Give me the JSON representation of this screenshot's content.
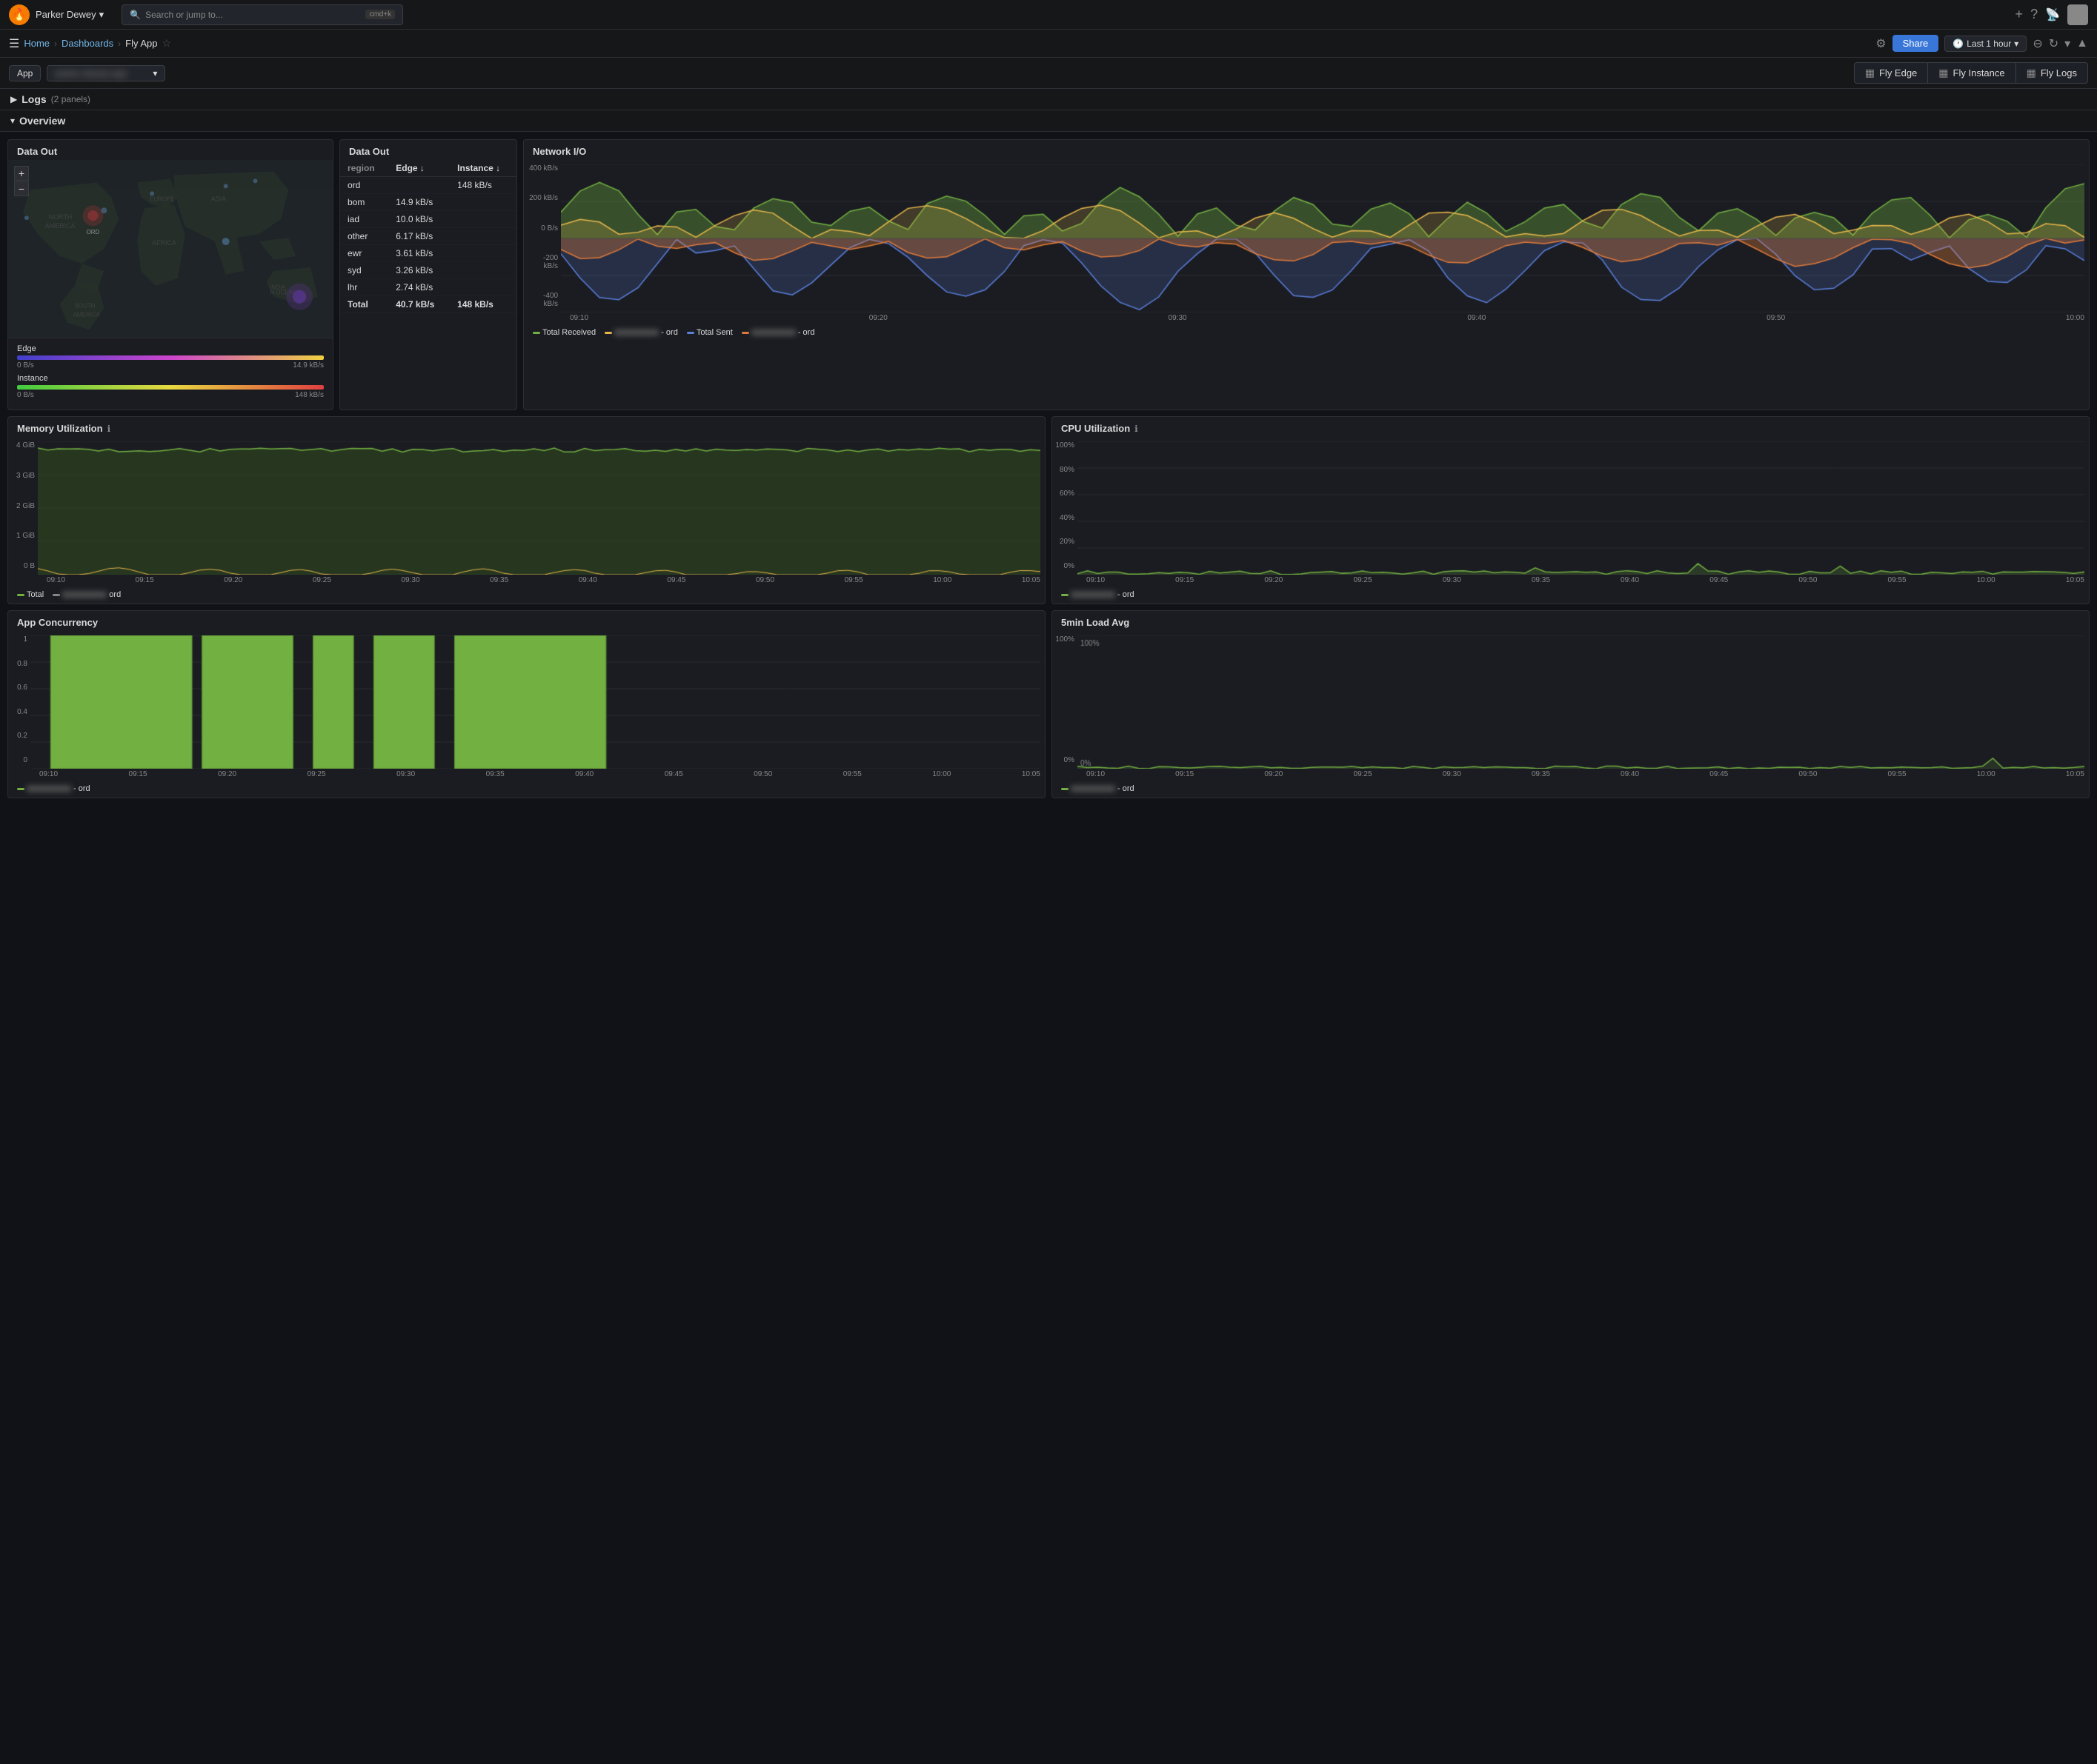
{
  "app": {
    "logo": "🔥",
    "org": "Parker Dewey",
    "search_placeholder": "Search or jump to...",
    "search_shortcut": "cmd+k"
  },
  "breadcrumb": {
    "home": "Home",
    "dashboards": "Dashboards",
    "current": "Fly App",
    "sep": "›"
  },
  "toolbar": {
    "share_label": "Share",
    "time_range": "Last 1 hour",
    "settings_icon": "⚙",
    "refresh_icon": "↻",
    "zoom_out_icon": "🔍",
    "chevron_icon": "▾"
  },
  "app_row": {
    "app_label": "App",
    "app_name": "parker-dewey-app",
    "tabs": [
      {
        "id": "fly-edge",
        "label": "Fly Edge",
        "icon": "▦"
      },
      {
        "id": "fly-instance",
        "label": "Fly Instance",
        "icon": "▦"
      },
      {
        "id": "fly-logs",
        "label": "Fly Logs",
        "icon": "▦"
      }
    ]
  },
  "logs_section": {
    "label": "Logs",
    "count": "(2 panels)"
  },
  "overview_section": {
    "label": "Overview"
  },
  "data_out_map": {
    "title": "Data Out",
    "edge_label": "Edge",
    "edge_min": "0 B/s",
    "edge_max": "14.9 kB/s",
    "instance_label": "Instance",
    "instance_min": "0 B/s",
    "instance_max": "148 kB/s"
  },
  "data_out_table": {
    "title": "Data Out",
    "headers": [
      "region",
      "Edge ↓",
      "Instance ↓"
    ],
    "rows": [
      {
        "region": "ord",
        "edge": "",
        "instance": "148 kB/s"
      },
      {
        "region": "bom",
        "edge": "14.9 kB/s",
        "instance": ""
      },
      {
        "region": "iad",
        "edge": "10.0 kB/s",
        "instance": ""
      },
      {
        "region": "other",
        "edge": "6.17 kB/s",
        "instance": ""
      },
      {
        "region": "ewr",
        "edge": "3.61 kB/s",
        "instance": ""
      },
      {
        "region": "syd",
        "edge": "3.26 kB/s",
        "instance": ""
      },
      {
        "region": "lhr",
        "edge": "2.74 kB/s",
        "instance": ""
      },
      {
        "region": "Total",
        "edge": "40.7 kB/s",
        "instance": "148 kB/s"
      }
    ]
  },
  "network_io": {
    "title": "Network I/O",
    "y_labels": [
      "400 kB/s",
      "200 kB/s",
      "0 B/s",
      "-200 kB/s",
      "-400 kB/s"
    ],
    "x_labels": [
      "09:10",
      "09:20",
      "09:30",
      "09:40",
      "09:50",
      "10:00"
    ],
    "legend": [
      {
        "label": "Total Received",
        "color": "#73b042"
      },
      {
        "label": "— ord",
        "color": "#e8b84b"
      },
      {
        "label": "Total Sent",
        "color": "#5b7fdb"
      },
      {
        "label": "— ord",
        "color": "#e07a3a"
      }
    ]
  },
  "memory_utilization": {
    "title": "Memory Utilization",
    "y_labels": [
      "4 GiB",
      "3 GiB",
      "2 GiB",
      "1 GiB",
      "0 B"
    ],
    "x_labels": [
      "09:10",
      "09:15",
      "09:20",
      "09:25",
      "09:30",
      "09:35",
      "09:40",
      "09:45",
      "09:50",
      "09:55",
      "10:00",
      "10:05"
    ],
    "legend": [
      {
        "label": "Total",
        "color": "#73b042"
      },
      {
        "label": "— ord",
        "color": "#888"
      }
    ]
  },
  "cpu_utilization": {
    "title": "CPU Utilization",
    "y_labels": [
      "100%",
      "80%",
      "60%",
      "40%",
      "20%",
      "0%"
    ],
    "x_labels": [
      "09:10",
      "09:15",
      "09:20",
      "09:25",
      "09:30",
      "09:35",
      "09:40",
      "09:45",
      "09:50",
      "09:55",
      "10:00",
      "10:05"
    ],
    "legend": [
      {
        "label": "— ord",
        "color": "#73b042"
      }
    ]
  },
  "app_concurrency": {
    "title": "App Concurrency",
    "y_labels": [
      "1",
      "0.8",
      "0.6",
      "0.4",
      "0.2",
      "0"
    ],
    "x_labels": [
      "09:10",
      "09:15",
      "09:20",
      "09:25",
      "09:30",
      "09:35",
      "09:40",
      "09:45",
      "09:50",
      "09:55",
      "10:00",
      "10:05"
    ],
    "legend": [
      {
        "label": "— ord",
        "color": "#888"
      }
    ]
  },
  "load_avg": {
    "title": "5min Load Avg",
    "y_labels": [
      "100%",
      "0%"
    ],
    "x_labels": [
      "09:10",
      "09:15",
      "09:20",
      "09:25",
      "09:30",
      "09:35",
      "09:40",
      "09:45",
      "09:50",
      "09:55",
      "10:00",
      "10:05"
    ],
    "legend": [
      {
        "label": "— ord",
        "color": "#73b042"
      }
    ]
  }
}
